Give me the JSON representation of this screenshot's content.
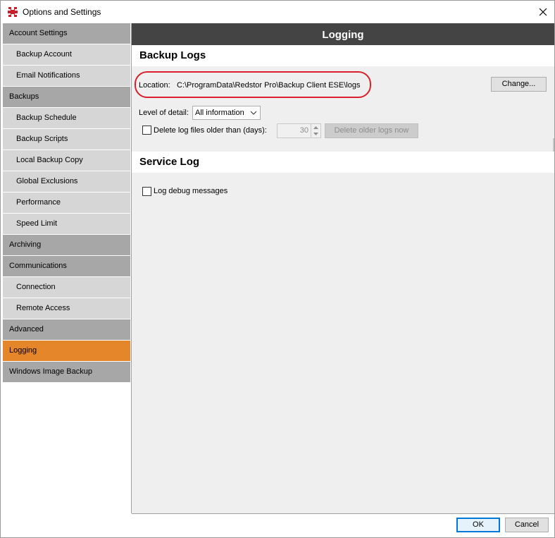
{
  "window": {
    "title": "Options and Settings"
  },
  "sidebar": {
    "items": [
      {
        "label": "Account Settings",
        "kind": "cat"
      },
      {
        "label": "Backup Account",
        "kind": "sub"
      },
      {
        "label": "Email Notifications",
        "kind": "sub"
      },
      {
        "label": "Backups",
        "kind": "cat"
      },
      {
        "label": "Backup Schedule",
        "kind": "sub"
      },
      {
        "label": "Backup Scripts",
        "kind": "sub"
      },
      {
        "label": "Local Backup Copy",
        "kind": "sub"
      },
      {
        "label": "Global Exclusions",
        "kind": "sub"
      },
      {
        "label": "Performance",
        "kind": "sub"
      },
      {
        "label": "Speed Limit",
        "kind": "sub"
      },
      {
        "label": "Archiving",
        "kind": "cat"
      },
      {
        "label": "Communications",
        "kind": "cat"
      },
      {
        "label": "Connection",
        "kind": "sub"
      },
      {
        "label": "Remote Access",
        "kind": "sub"
      },
      {
        "label": "Advanced",
        "kind": "cat"
      },
      {
        "label": "Logging",
        "kind": "active"
      },
      {
        "label": "Windows Image Backup",
        "kind": "cat"
      }
    ]
  },
  "content": {
    "header": "Logging",
    "backup_logs": {
      "title": "Backup Logs",
      "location_label": "Location:",
      "location_value": "C:\\ProgramData\\Redstor Pro\\Backup Client ESE\\logs",
      "change_button": "Change...",
      "level_label": "Level of detail:",
      "level_value": "All information",
      "delete_label": "Delete log files older than (days):",
      "delete_checked": false,
      "days_value": "30",
      "delete_now_button": "Delete older logs now"
    },
    "service_log": {
      "title": "Service Log",
      "debug_label": "Log debug messages",
      "debug_checked": false
    }
  },
  "footer": {
    "ok_button": "OK",
    "cancel_button": "Cancel"
  },
  "colors": {
    "category_bg": "#a7a7a7",
    "subitem_bg": "#d6d6d6",
    "active_bg": "#e6862a",
    "header_bg": "#444444",
    "highlight_ring": "#d8202a",
    "brand_red": "#c8202a"
  },
  "icons": {
    "app": "redstor-logo-icon",
    "close": "close-icon",
    "dropdown": "chevron-down-icon"
  }
}
